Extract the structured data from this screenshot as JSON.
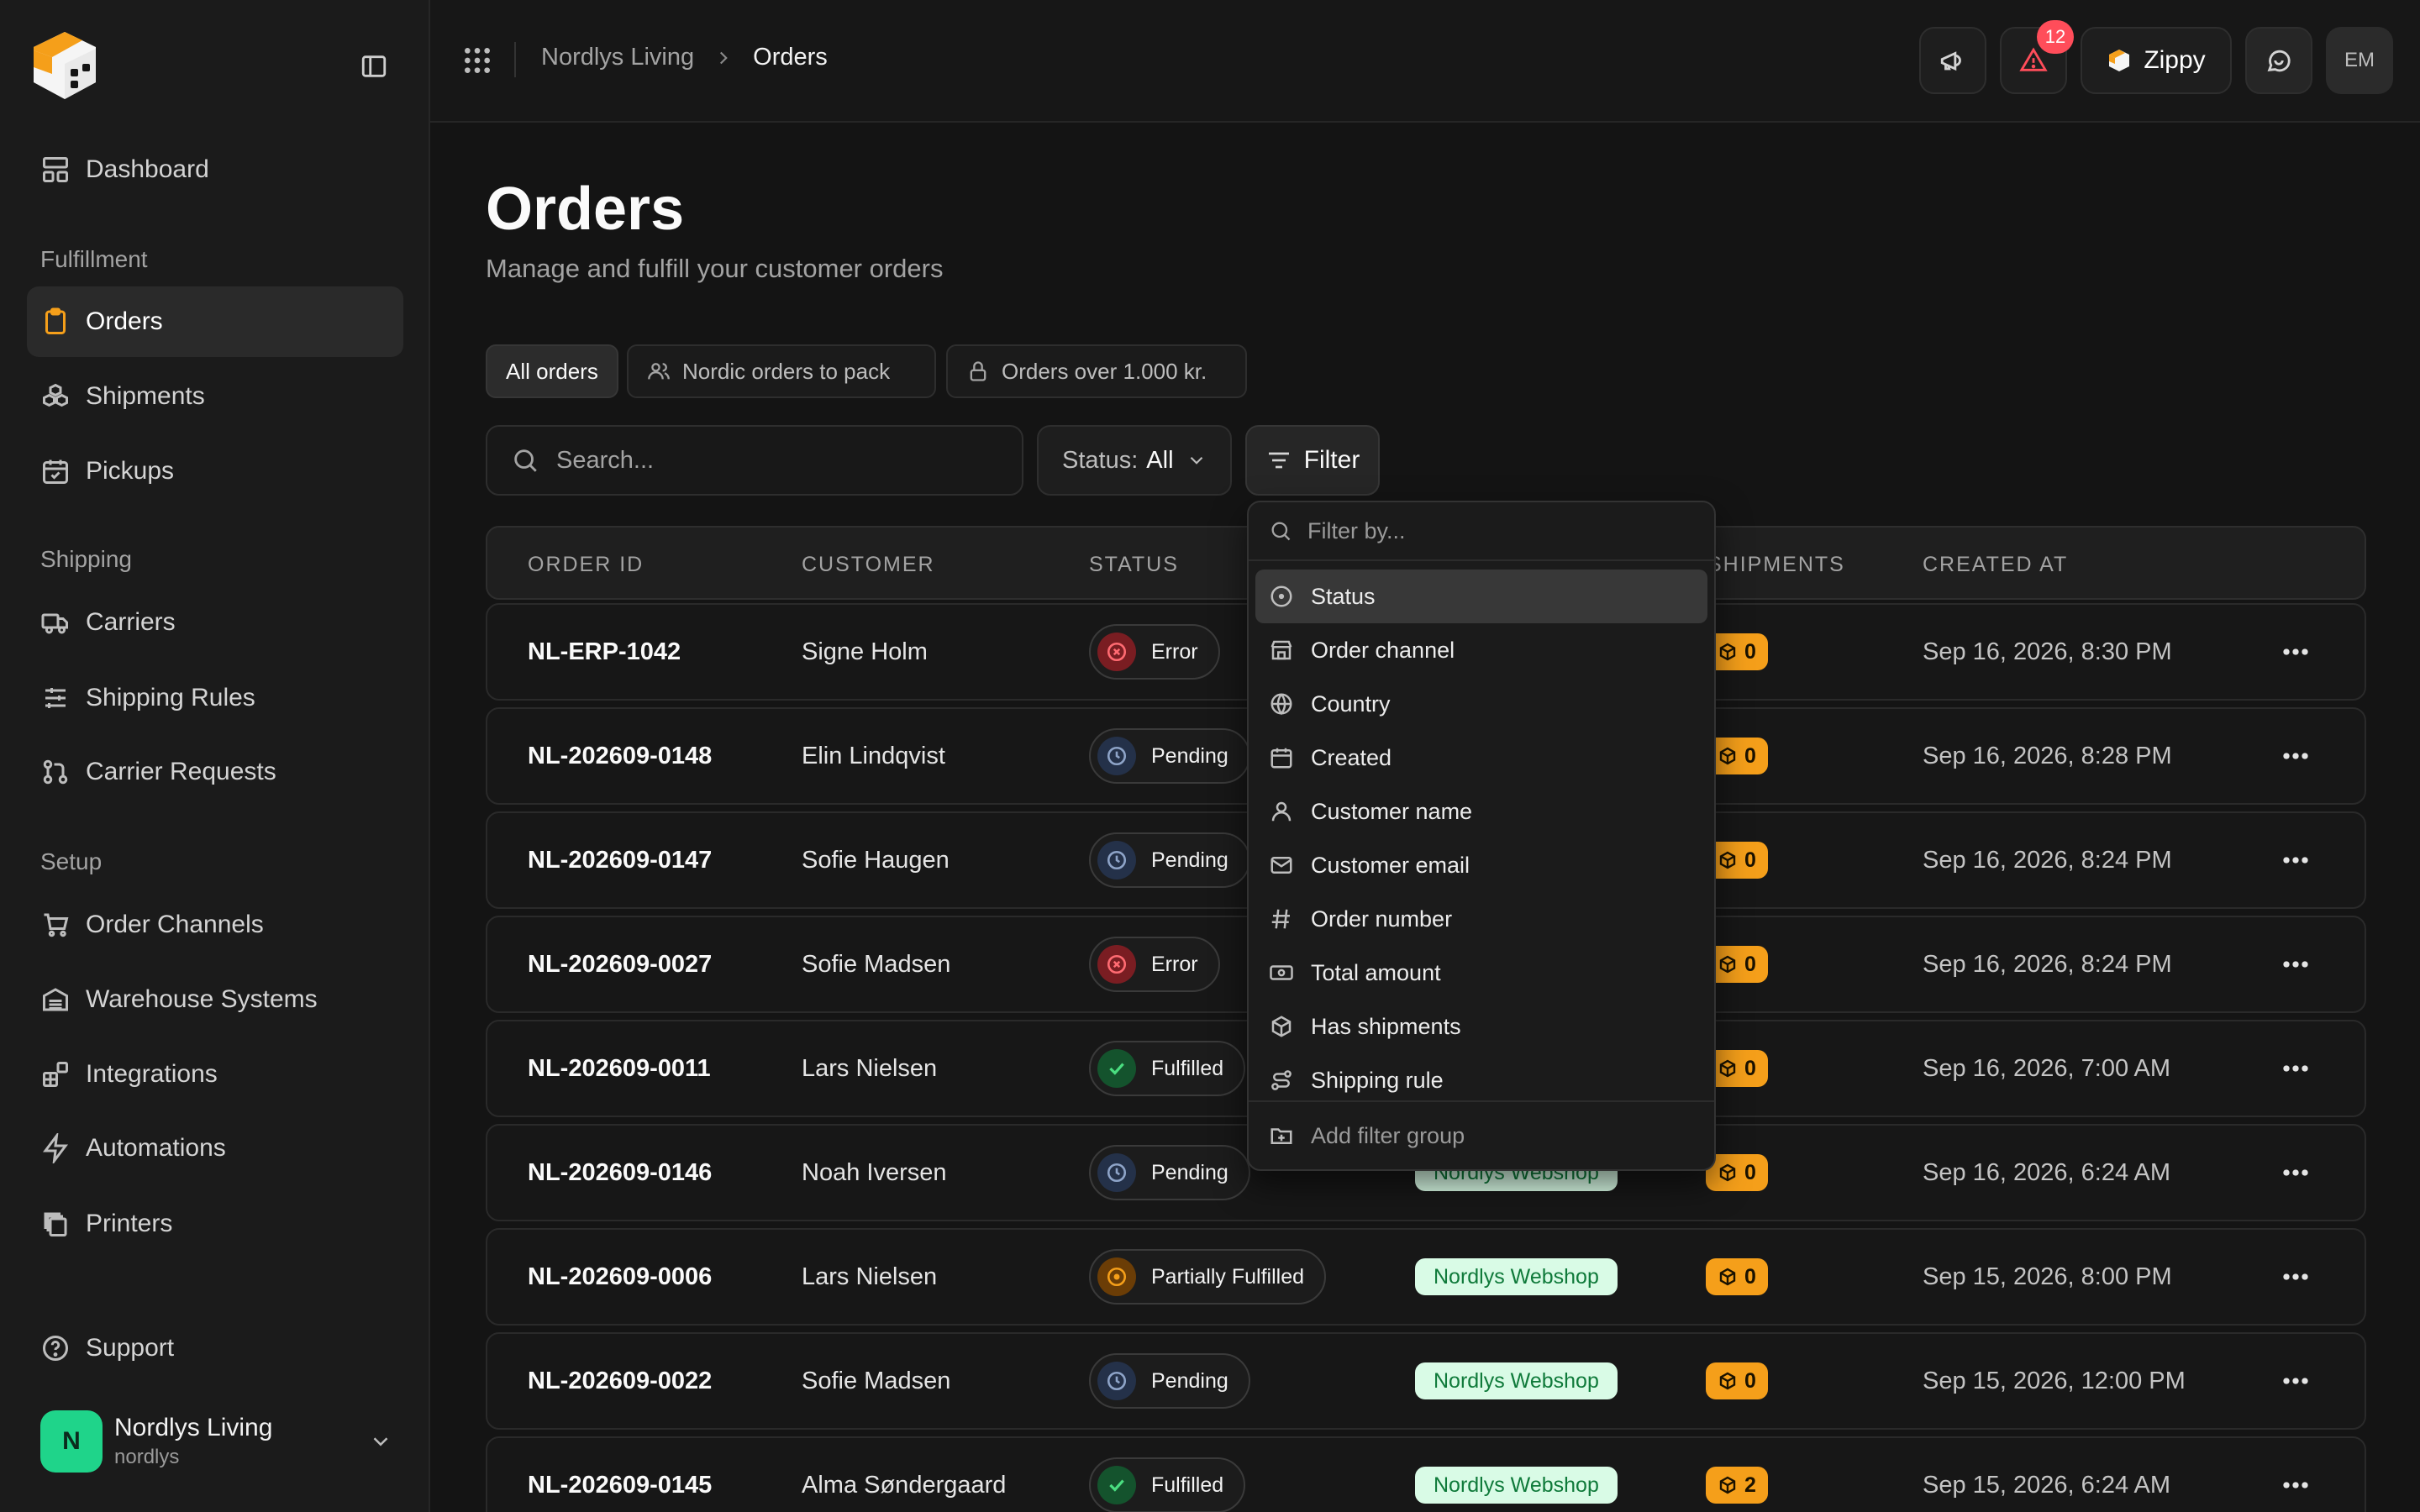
{
  "sidebar": {
    "sections": [
      "Fulfillment",
      "Shipping",
      "Setup"
    ],
    "items": [
      {
        "label": "Dashboard",
        "icon": "dashboard-icon"
      },
      {
        "label": "Orders",
        "icon": "clipboard-icon",
        "active": true
      },
      {
        "label": "Shipments",
        "icon": "boxes-icon"
      },
      {
        "label": "Pickups",
        "icon": "calendar-check-icon"
      },
      {
        "label": "Carriers",
        "icon": "truck-icon"
      },
      {
        "label": "Shipping Rules",
        "icon": "sliders-icon"
      },
      {
        "label": "Carrier Requests",
        "icon": "git-pull-request-icon"
      },
      {
        "label": "Order Channels",
        "icon": "shopping-cart-icon"
      },
      {
        "label": "Warehouse Systems",
        "icon": "warehouse-icon"
      },
      {
        "label": "Integrations",
        "icon": "blocks-icon"
      },
      {
        "label": "Automations",
        "icon": "zap-icon"
      },
      {
        "label": "Printers",
        "icon": "copy-icon"
      }
    ],
    "support_label": "Support",
    "org": {
      "initial": "N",
      "name": "Nordlys Living",
      "slug": "nordlys"
    }
  },
  "topbar": {
    "breadcrumb_parent": "Nordlys Living",
    "breadcrumb_current": "Orders",
    "alerts_count": "12",
    "zippy_label": "Zippy",
    "user_initials": "EM"
  },
  "page": {
    "title": "Orders",
    "subtitle": "Manage and fulfill your customer orders"
  },
  "views": [
    {
      "label": "All orders",
      "active": true
    },
    {
      "label": "Nordic orders to pack",
      "icon": "users-icon"
    },
    {
      "label": "Orders over 1.000 kr.",
      "icon": "lock-icon"
    }
  ],
  "toolbar": {
    "search_placeholder": "Search...",
    "status_label": "Status:",
    "status_value": "All",
    "filter_label": "Filter"
  },
  "table": {
    "headers": [
      "ORDER ID",
      "CUSTOMER",
      "STATUS",
      "SHIPMENTS",
      "CREATED AT"
    ],
    "rows": [
      {
        "id": "NL-ERP-1042",
        "customer": "Signe Holm",
        "status": "Error",
        "channel": "",
        "shipments": "0",
        "created": "Sep 16, 2026, 8:30 PM"
      },
      {
        "id": "NL-202609-0148",
        "customer": "Elin Lindqvist",
        "status": "Pending",
        "channel": "",
        "shipments": "0",
        "created": "Sep 16, 2026, 8:28 PM"
      },
      {
        "id": "NL-202609-0147",
        "customer": "Sofie Haugen",
        "status": "Pending",
        "channel": "",
        "shipments": "0",
        "created": "Sep 16, 2026, 8:24 PM"
      },
      {
        "id": "NL-202609-0027",
        "customer": "Sofie Madsen",
        "status": "Error",
        "channel": "",
        "shipments": "0",
        "created": "Sep 16, 2026, 8:24 PM"
      },
      {
        "id": "NL-202609-0011",
        "customer": "Lars Nielsen",
        "status": "Fulfilled",
        "channel": "",
        "shipments": "0",
        "created": "Sep 16, 2026, 7:00 AM"
      },
      {
        "id": "NL-202609-0146",
        "customer": "Noah Iversen",
        "status": "Pending",
        "channel": "Nordlys Webshop",
        "shipments": "0",
        "created": "Sep 16, 2026, 6:24 AM"
      },
      {
        "id": "NL-202609-0006",
        "customer": "Lars Nielsen",
        "status": "Partially Fulfilled",
        "channel": "Nordlys Webshop",
        "shipments": "0",
        "created": "Sep 15, 2026, 8:00 PM"
      },
      {
        "id": "NL-202609-0022",
        "customer": "Sofie Madsen",
        "status": "Pending",
        "channel": "Nordlys Webshop",
        "shipments": "0",
        "created": "Sep 15, 2026, 12:00 PM"
      },
      {
        "id": "NL-202609-0145",
        "customer": "Alma Søndergaard",
        "status": "Fulfilled",
        "channel": "Nordlys Webshop",
        "shipments": "2",
        "created": "Sep 15, 2026, 6:24 AM"
      }
    ]
  },
  "filter_menu": {
    "placeholder": "Filter by...",
    "items": [
      {
        "label": "Status",
        "icon": "circle-dot-icon"
      },
      {
        "label": "Order channel",
        "icon": "store-icon"
      },
      {
        "label": "Country",
        "icon": "globe-icon"
      },
      {
        "label": "Created",
        "icon": "calendar-icon"
      },
      {
        "label": "Customer name",
        "icon": "user-icon"
      },
      {
        "label": "Customer email",
        "icon": "mail-icon"
      },
      {
        "label": "Order number",
        "icon": "hash-icon"
      },
      {
        "label": "Total amount",
        "icon": "banknote-icon"
      },
      {
        "label": "Has shipments",
        "icon": "package-icon"
      },
      {
        "label": "Shipping rule",
        "icon": "route-icon"
      }
    ],
    "add_group_label": "Add filter group"
  },
  "colors": {
    "accent": "#f59f1a",
    "error": "#e5484d",
    "pending": "#3b4a66",
    "fulfilled": "#16a34a",
    "partial": "#f59f1a",
    "channel_bg": "#d9fbe6",
    "org_avatar": "#1fd48a",
    "alert_badge": "#ff4d5a"
  }
}
